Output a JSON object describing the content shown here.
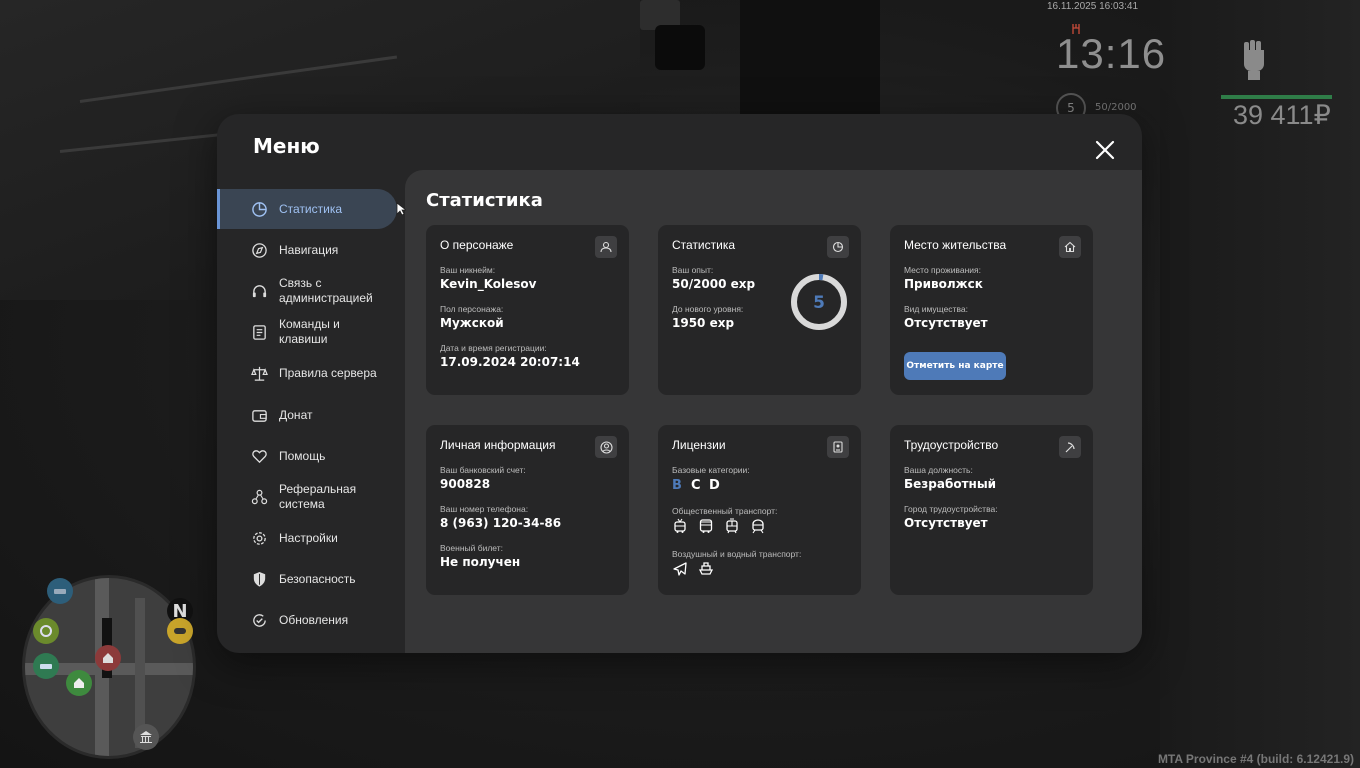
{
  "hud": {
    "datetime": "16.11.2025 16:03:41",
    "clock": "13:16",
    "level": "5",
    "exp": "50/2000",
    "money": "39 411₽",
    "build": "MTA Province #4 (build: 6.12421.9)",
    "compass": "N"
  },
  "modal": {
    "title": "Меню",
    "close_icon": "close-icon"
  },
  "sidebar": {
    "items": [
      {
        "label": "Статистика",
        "icon": "pie-chart-icon",
        "active": true
      },
      {
        "label": "Навигация",
        "icon": "compass-icon"
      },
      {
        "label": "Связь с администрацией",
        "icon": "headset-icon"
      },
      {
        "label": "Команды и клавиши",
        "icon": "document-icon"
      },
      {
        "label": "Правила сервера",
        "icon": "scales-icon"
      },
      {
        "label": "Донат",
        "icon": "wallet-icon"
      },
      {
        "label": "Помощь",
        "icon": "heart-hands-icon"
      },
      {
        "label": "Реферальная система",
        "icon": "network-icon"
      },
      {
        "label": "Настройки",
        "icon": "gear-icon"
      },
      {
        "label": "Безопасность",
        "icon": "shield-icon"
      },
      {
        "label": "Обновления",
        "icon": "refresh-check-icon"
      }
    ]
  },
  "content": {
    "title": "Статистика",
    "character": {
      "title": "О персонаже",
      "nickname_label": "Ваш никнейм:",
      "nickname": "Kevin_Kolesov",
      "gender_label": "Пол персонажа:",
      "gender": "Мужской",
      "reg_label": "Дата и время регистрации:",
      "reg": "17.09.2024 20:07:14"
    },
    "stats": {
      "title": "Статистика",
      "exp_label": "Ваш опыт:",
      "exp": "50/2000 exp",
      "next_label": "До нового уровня:",
      "next": "1950 exp",
      "level": "5",
      "progress": 0.025
    },
    "residence": {
      "title": "Место жительства",
      "place_label": "Место проживания:",
      "place": "Приволжск",
      "property_label": "Вид имущества:",
      "property": "Отсутствует",
      "map_button": "Отметить на карте"
    },
    "personal": {
      "title": "Личная информация",
      "bank_label": "Ваш банковский счет:",
      "bank": "900828",
      "phone_label": "Ваш номер телефона:",
      "phone": "8 (963) 120-34-86",
      "military_label": "Военный билет:",
      "military": "Не получен"
    },
    "licenses": {
      "title": "Лицензии",
      "base_label": "Базовые категории:",
      "categories": [
        "B",
        "C",
        "D"
      ],
      "public_label": "Общественный транспорт:",
      "public_icons": [
        "trolleybus-icon",
        "bus-icon",
        "tram-icon",
        "metro-icon"
      ],
      "air_label": "Воздушный и водный транспорт:",
      "air_icons": [
        "plane-icon",
        "boat-icon"
      ]
    },
    "employment": {
      "title": "Трудоустройство",
      "position_label": "Ваша должность:",
      "position": "Безработный",
      "city_label": "Город трудоустройства:",
      "city": "Отсутствует"
    }
  },
  "colors": {
    "accent": "#4e7ab8",
    "active_text": "#9fc1f2",
    "modal_bg": "#262627",
    "content_bg": "#363637",
    "card_bg": "#262627"
  }
}
